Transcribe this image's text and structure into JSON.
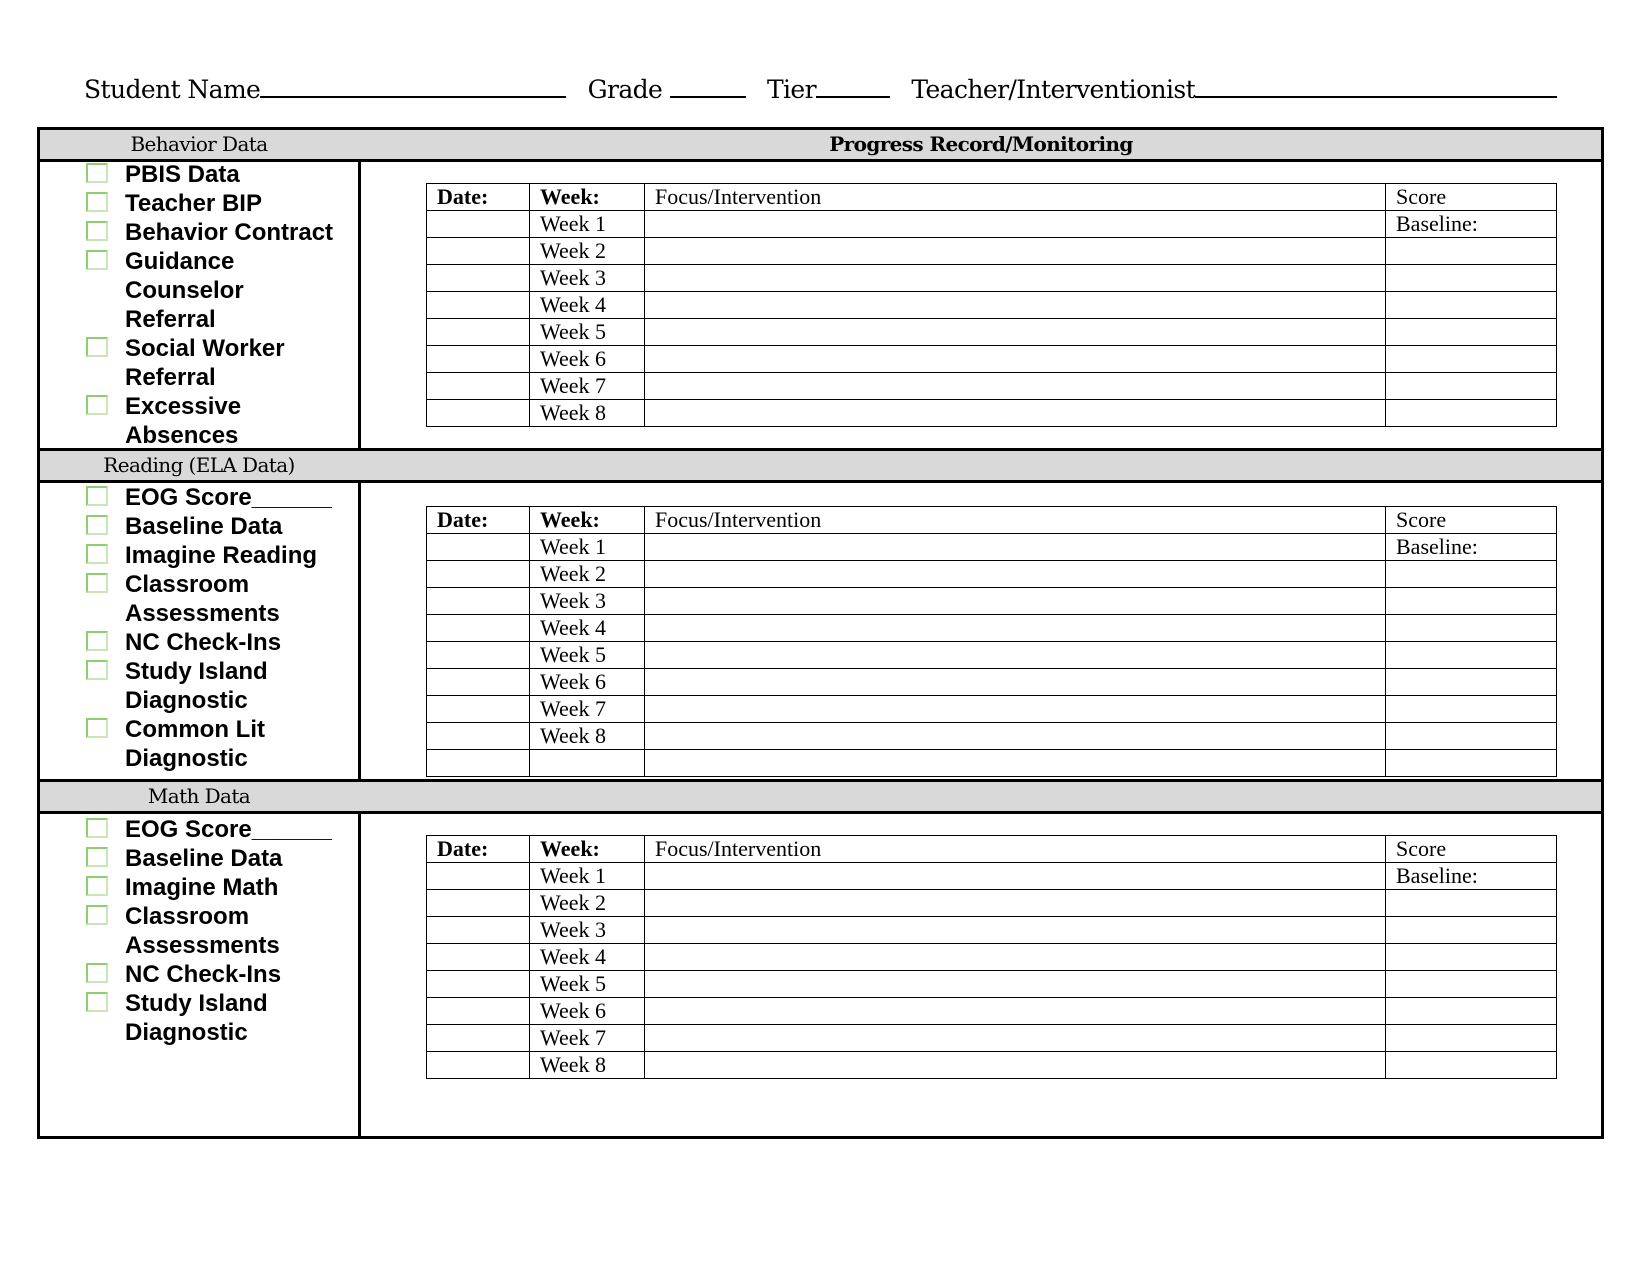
{
  "header": {
    "student_name_label": "Student Name",
    "grade_label": "Grade",
    "tier_label": "Tier",
    "teacher_label": "Teacher/Interventionist"
  },
  "sections": [
    {
      "left_title": "Behavior Data",
      "right_title": "Progress Record/Monitoring",
      "checklist": [
        {
          "label": "PBIS Data",
          "checked": false
        },
        {
          "label": "Teacher BIP",
          "checked": false
        },
        {
          "label": "Behavior Contract",
          "checked": false
        },
        {
          "label": "Guidance Counselor Referral",
          "checked": false
        },
        {
          "label": "Social Worker Referral",
          "checked": false
        },
        {
          "label": "Excessive Absences",
          "checked": false
        }
      ]
    },
    {
      "left_title": "Reading (ELA Data)",
      "right_title": "",
      "checklist": [
        {
          "label": "EOG Score______",
          "checked": false
        },
        {
          "label": "Baseline Data",
          "checked": false
        },
        {
          "label": "Imagine Reading",
          "checked": false
        },
        {
          "label": "Classroom Assessments",
          "checked": false
        },
        {
          "label": "NC Check-Ins",
          "checked": false
        },
        {
          "label": "Study Island Diagnostic",
          "checked": false
        },
        {
          "label": "Common Lit Diagnostic",
          "checked": false
        }
      ]
    },
    {
      "left_title": "Math Data",
      "right_title": "",
      "checklist": [
        {
          "label": "EOG Score______",
          "checked": false
        },
        {
          "label": "Baseline Data",
          "checked": false
        },
        {
          "label": "Imagine Math",
          "checked": false
        },
        {
          "label": "Classroom Assessments",
          "checked": false
        },
        {
          "label": "NC Check-Ins",
          "checked": false
        },
        {
          "label": "Study Island Diagnostic",
          "checked": false
        }
      ]
    }
  ],
  "progress_table": {
    "headers": {
      "date": "Date:",
      "week": "Week:",
      "focus": "Focus/Intervention",
      "score": "Score"
    },
    "baseline_label": "Baseline:",
    "weeks": [
      "Week 1",
      "Week 2",
      "Week 3",
      "Week 4",
      "Week 5",
      "Week 6",
      "Week 7",
      "Week 8"
    ]
  }
}
